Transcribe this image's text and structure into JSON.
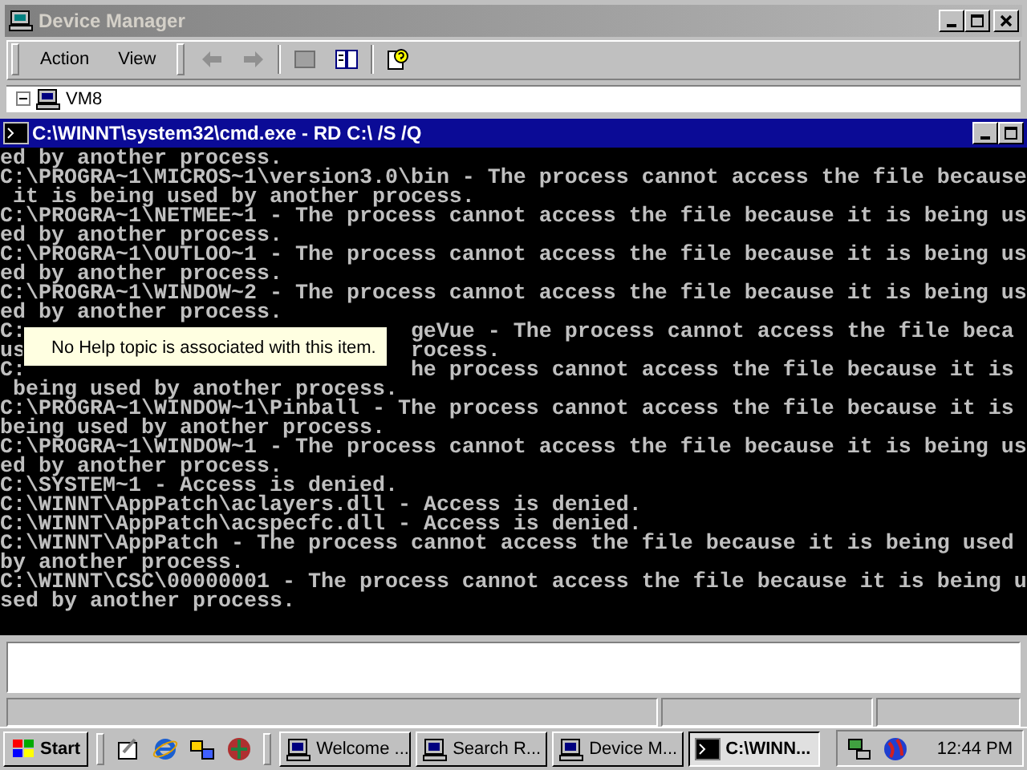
{
  "device_manager": {
    "title": "Device Manager",
    "menu": [
      "Action",
      "View"
    ],
    "tree": [
      {
        "label": "VM8",
        "expanded": true
      }
    ]
  },
  "console": {
    "title": "C:\\WINNT\\system32\\cmd.exe - RD C:\\ /S /Q",
    "lines": [
      {
        "kind": "line",
        "text": "ed by another process."
      },
      {
        "kind": "line",
        "text": "C:\\PROGRA~1\\MICROS~1\\version3.0\\bin - The process cannot access the file because"
      },
      {
        "kind": "line",
        "text": " it is being used by another process."
      },
      {
        "kind": "line",
        "text": "C:\\PROGRA~1\\NETMEE~1 - The process cannot access the file because it is being us"
      },
      {
        "kind": "line",
        "text": "ed by another process."
      },
      {
        "kind": "line",
        "text": "C:\\PROGRA~1\\OUTLOO~1 - The process cannot access the file because it is being us"
      },
      {
        "kind": "line",
        "text": "ed by another process."
      },
      {
        "kind": "line",
        "text": "C:\\PROGRA~1\\WINDOW~2 - The process cannot access the file because it is being us"
      },
      {
        "kind": "line",
        "text": "ed by another process."
      },
      {
        "kind": "split",
        "left": "C:",
        "right": "geVue - The process cannot access the file beca"
      },
      {
        "kind": "split",
        "left": "us",
        "right": "rocess."
      },
      {
        "kind": "split",
        "left": "C:",
        "right": "he process cannot access the file because it is"
      },
      {
        "kind": "line",
        "text": " being used by another process."
      },
      {
        "kind": "line",
        "text": "C:\\PROGRA~1\\WINDOW~1\\Pinball - The process cannot access the file because it is"
      },
      {
        "kind": "line",
        "text": "being used by another process."
      },
      {
        "kind": "line",
        "text": "C:\\PROGRA~1\\WINDOW~1 - The process cannot access the file because it is being us"
      },
      {
        "kind": "line",
        "text": "ed by another process."
      },
      {
        "kind": "line",
        "text": "C:\\SYSTEM~1 - Access is denied."
      },
      {
        "kind": "line",
        "text": "C:\\WINNT\\AppPatch\\aclayers.dll - Access is denied."
      },
      {
        "kind": "line",
        "text": "C:\\WINNT\\AppPatch\\acspecfc.dll - Access is denied."
      },
      {
        "kind": "line",
        "text": "C:\\WINNT\\AppPatch - The process cannot access the file because it is being used"
      },
      {
        "kind": "line",
        "text": "by another process."
      },
      {
        "kind": "line",
        "text": "C:\\WINNT\\CSC\\00000001 - The process cannot access the file because it is being u"
      },
      {
        "kind": "line",
        "text": "sed by another process."
      }
    ]
  },
  "tooltip": {
    "text": "No Help topic is associated with this item."
  },
  "taskbar": {
    "start": "Start",
    "tasks": [
      {
        "label": "Welcome ...",
        "selected": false
      },
      {
        "label": "Search R...",
        "selected": false
      },
      {
        "label": "Device M...",
        "selected": false
      },
      {
        "label": "C:\\WINN...",
        "selected": true
      }
    ],
    "clock": "12:44 PM"
  }
}
